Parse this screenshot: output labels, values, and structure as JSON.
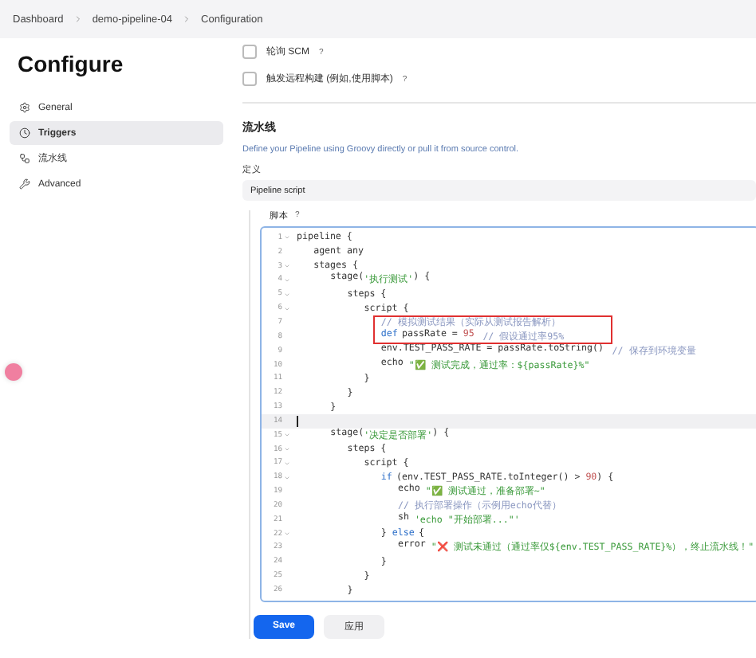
{
  "breadcrumb": [
    "Dashboard",
    "demo-pipeline-04",
    "Configuration"
  ],
  "page_title": "Configure",
  "sidebar": {
    "items": [
      {
        "label": "General",
        "selected": false
      },
      {
        "label": "Triggers",
        "selected": true
      },
      {
        "label": "流水线",
        "selected": false
      },
      {
        "label": "Advanced",
        "selected": false
      }
    ]
  },
  "triggers": [
    {
      "label": "轮询 SCM",
      "help": "?",
      "checked": false
    },
    {
      "label": "触发远程构建 (例如,使用脚本)",
      "help": "?",
      "checked": false
    }
  ],
  "pipeline": {
    "title": "流水线",
    "description": "Define your Pipeline using Groovy directly or pull it from source control.",
    "definition_label": "定义",
    "definition_value": "Pipeline script",
    "script_label": "脚本",
    "script_help": "?"
  },
  "code": [
    {
      "number": "1",
      "fold": true,
      "active": false,
      "highlighted": false,
      "tokens": [
        {
          "kind": "plain",
          "text": "pipeline {"
        }
      ]
    },
    {
      "number": "2",
      "fold": false,
      "active": false,
      "highlighted": false,
      "tokens": [
        {
          "kind": "plain",
          "text": "    agent any"
        }
      ]
    },
    {
      "number": "3",
      "fold": true,
      "active": false,
      "highlighted": false,
      "tokens": [
        {
          "kind": "plain",
          "text": "    stages {"
        }
      ]
    },
    {
      "number": "4",
      "fold": true,
      "active": false,
      "highlighted": false,
      "tokens": [
        {
          "kind": "plain",
          "text": "        stage("
        },
        {
          "kind": "string",
          "text": "'执行测试'"
        },
        {
          "kind": "plain",
          "text": ") {"
        }
      ]
    },
    {
      "number": "5",
      "fold": true,
      "active": false,
      "highlighted": false,
      "tokens": [
        {
          "kind": "plain",
          "text": "            steps {"
        }
      ]
    },
    {
      "number": "6",
      "fold": true,
      "active": false,
      "highlighted": false,
      "tokens": [
        {
          "kind": "plain",
          "text": "                script {"
        }
      ]
    },
    {
      "number": "7",
      "fold": false,
      "active": false,
      "highlighted": true,
      "tokens": [
        {
          "kind": "comment",
          "text": "                    // 模拟测试结果（实际从测试报告解析）"
        }
      ]
    },
    {
      "number": "8",
      "fold": false,
      "active": false,
      "highlighted": true,
      "tokens": [
        {
          "kind": "keyword",
          "text": "                    def"
        },
        {
          "kind": "plain",
          "text": " passRate = "
        },
        {
          "kind": "number",
          "text": "95"
        },
        {
          "kind": "comment",
          "text": "  // 假设通过率95%"
        }
      ]
    },
    {
      "number": "9",
      "fold": false,
      "active": false,
      "highlighted": false,
      "tokens": [
        {
          "kind": "plain",
          "text": "                    env.TEST_PASS_RATE = passRate.toString()"
        },
        {
          "kind": "comment",
          "text": "  // 保存到环境变量"
        }
      ]
    },
    {
      "number": "10",
      "fold": false,
      "active": false,
      "highlighted": false,
      "tokens": [
        {
          "kind": "plain",
          "text": "                    echo "
        },
        {
          "kind": "string",
          "text": "\"✅ 测试完成，通过率：${passRate}%\""
        }
      ]
    },
    {
      "number": "11",
      "fold": false,
      "active": false,
      "highlighted": false,
      "tokens": [
        {
          "kind": "plain",
          "text": "                }"
        }
      ]
    },
    {
      "number": "12",
      "fold": false,
      "active": false,
      "highlighted": false,
      "tokens": [
        {
          "kind": "plain",
          "text": "            }"
        }
      ]
    },
    {
      "number": "13",
      "fold": false,
      "active": false,
      "highlighted": false,
      "tokens": [
        {
          "kind": "plain",
          "text": "        }"
        }
      ]
    },
    {
      "number": "14",
      "fold": false,
      "active": true,
      "highlighted": false
    },
    {
      "number": "15",
      "fold": true,
      "active": false,
      "highlighted": false,
      "tokens": [
        {
          "kind": "plain",
          "text": "        stage("
        },
        {
          "kind": "string",
          "text": "'决定是否部署'"
        },
        {
          "kind": "plain",
          "text": ") {"
        }
      ]
    },
    {
      "number": "16",
      "fold": true,
      "active": false,
      "highlighted": false,
      "tokens": [
        {
          "kind": "plain",
          "text": "            steps {"
        }
      ]
    },
    {
      "number": "17",
      "fold": true,
      "active": false,
      "highlighted": false,
      "tokens": [
        {
          "kind": "plain",
          "text": "                script {"
        }
      ]
    },
    {
      "number": "18",
      "fold": true,
      "active": false,
      "highlighted": false,
      "tokens": [
        {
          "kind": "keyword",
          "text": "                    if"
        },
        {
          "kind": "plain",
          "text": " (env.TEST_PASS_RATE.toInteger() > "
        },
        {
          "kind": "number",
          "text": "90"
        },
        {
          "kind": "plain",
          "text": ") {"
        }
      ]
    },
    {
      "number": "19",
      "fold": false,
      "active": false,
      "highlighted": false,
      "tokens": [
        {
          "kind": "plain",
          "text": "                        echo "
        },
        {
          "kind": "string",
          "text": "\"✅ 测试通过，准备部署~\""
        }
      ]
    },
    {
      "number": "20",
      "fold": false,
      "active": false,
      "highlighted": false,
      "tokens": [
        {
          "kind": "comment",
          "text": "                        // 执行部署操作（示例用echo代替）"
        }
      ]
    },
    {
      "number": "21",
      "fold": false,
      "active": false,
      "highlighted": false,
      "tokens": [
        {
          "kind": "plain",
          "text": "                        sh "
        },
        {
          "kind": "string",
          "text": "'echo \"开始部署...\"'"
        }
      ]
    },
    {
      "number": "22",
      "fold": true,
      "active": false,
      "highlighted": false,
      "tokens": [
        {
          "kind": "plain",
          "text": "                    } "
        },
        {
          "kind": "keyword",
          "text": "else"
        },
        {
          "kind": "plain",
          "text": " {"
        }
      ]
    },
    {
      "number": "23",
      "fold": false,
      "active": false,
      "highlighted": false,
      "tokens": [
        {
          "kind": "plain",
          "text": "                        error "
        },
        {
          "kind": "string",
          "text": "\"❌ 测试未通过（通过率仅${env.TEST_PASS_RATE}%），终止流水线！\""
        }
      ]
    },
    {
      "number": "24",
      "fold": false,
      "active": false,
      "highlighted": false,
      "tokens": [
        {
          "kind": "plain",
          "text": "                    }"
        }
      ]
    },
    {
      "number": "25",
      "fold": false,
      "active": false,
      "highlighted": false,
      "tokens": [
        {
          "kind": "plain",
          "text": "                }"
        }
      ]
    },
    {
      "number": "26",
      "fold": false,
      "active": false,
      "highlighted": false,
      "tokens": [
        {
          "kind": "plain",
          "text": "            }"
        }
      ]
    }
  ],
  "buttons": [
    {
      "label": "Save",
      "kind": "primary"
    },
    {
      "label": "应用",
      "kind": "secondary"
    }
  ]
}
